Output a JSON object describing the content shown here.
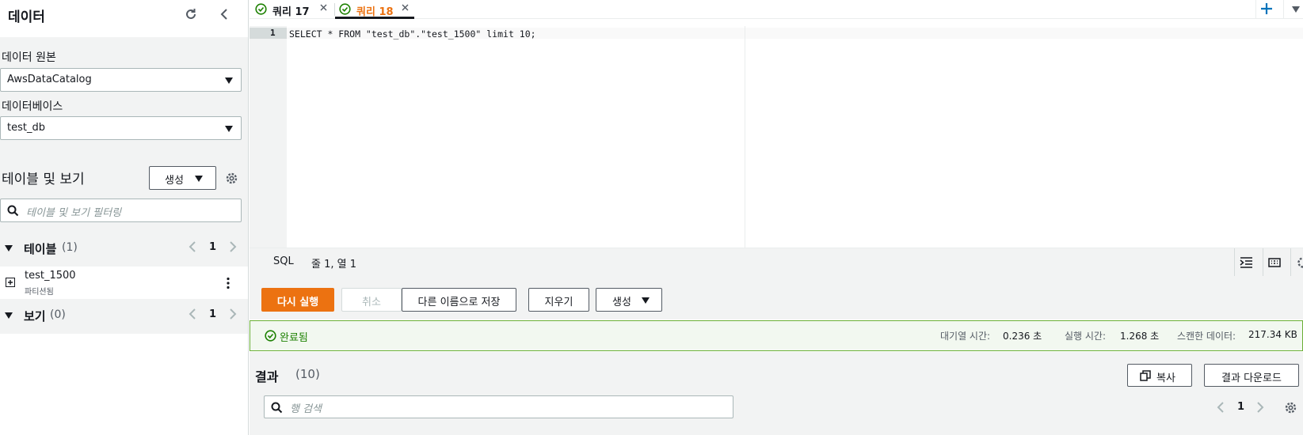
{
  "sidebar": {
    "title": "데이터",
    "data_source_label": "데이터 원본",
    "data_source_value": "AwsDataCatalog",
    "database_label": "데이터베이스",
    "database_value": "test_db",
    "tables_views_title": "테이블 및 보기",
    "create_label": "생성",
    "filter_placeholder": "테이블 및 보기 필터링",
    "tables_label": "테이블",
    "tables_count": "(1)",
    "tables_page": "1",
    "table_items": [
      {
        "name": "test_1500",
        "subtitle": "파티션됨"
      }
    ],
    "views_label": "보기",
    "views_count": "(0)",
    "views_page": "1"
  },
  "tabs": [
    {
      "label": "쿼리 17",
      "active": false
    },
    {
      "label": "쿼리 18",
      "active": true
    }
  ],
  "editor": {
    "line_number": "1",
    "code": "SELECT * FROM \"test_db\".\"test_1500\" limit 10;"
  },
  "status": {
    "language": "SQL",
    "position": "줄 1, 열 1"
  },
  "actions": {
    "run_again": "다시 실행",
    "cancel": "취소",
    "save_as": "다른 이름으로 저장",
    "clear": "지우기",
    "create": "생성"
  },
  "completion": {
    "status": "완료됨",
    "queue_time_label": "대기열 시간:",
    "queue_time_value": "0.236 초",
    "run_time_label": "실행 시간:",
    "run_time_value": "1.268 초",
    "scanned_label": "스캔한 데이터:",
    "scanned_value": "217.34 KB"
  },
  "results": {
    "title": "결과",
    "count": "(10)",
    "copy_label": "복사",
    "download_label": "결과 다운로드",
    "search_placeholder": "행 검색",
    "page": "1"
  },
  "colors": {
    "primary": "#ec7211",
    "success": "#1d8102",
    "border": "#aab7b8",
    "panel_bg": "#f2f3f3"
  }
}
